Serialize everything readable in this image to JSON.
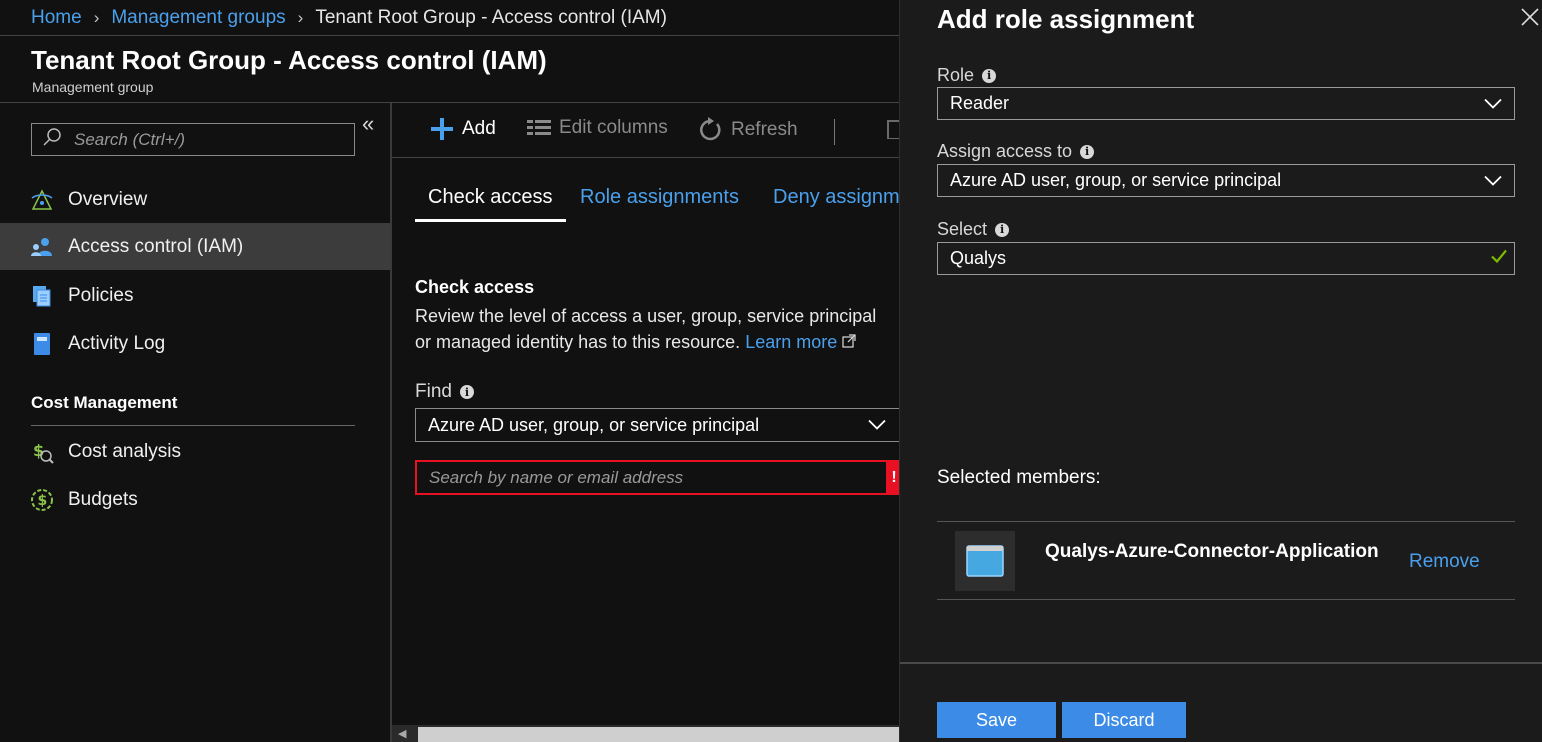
{
  "breadcrumb": {
    "home": "Home",
    "management_groups": "Management groups",
    "current": "Tenant Root Group - Access control (IAM)"
  },
  "header": {
    "title": "Tenant Root Group - Access control (IAM)",
    "subtitle": "Management group"
  },
  "sidebar": {
    "search_placeholder": "Search (Ctrl+/)",
    "collapse_glyph": "«",
    "items": [
      {
        "label": "Overview",
        "icon": "overview-icon"
      },
      {
        "label": "Access control (IAM)",
        "icon": "iam-people-icon",
        "active": true
      },
      {
        "label": "Policies",
        "icon": "policies-icon"
      },
      {
        "label": "Activity Log",
        "icon": "activity-log-icon"
      }
    ],
    "section_title": "Cost Management",
    "cost_items": [
      {
        "label": "Cost analysis",
        "icon": "cost-analysis-icon"
      },
      {
        "label": "Budgets",
        "icon": "budgets-icon"
      }
    ]
  },
  "toolbar": {
    "add": "Add",
    "edit_columns": "Edit columns",
    "refresh": "Refresh"
  },
  "tabs": {
    "check_access": "Check access",
    "role_assignments": "Role assignments",
    "deny_assignments": "Deny assignm"
  },
  "check_access": {
    "title": "Check access",
    "desc_line1": "Review the level of access a user, group, service principal",
    "desc_line2": "or managed identity has to this resource.",
    "learn_more": "Learn more",
    "find_label": "Find",
    "find_value": "Azure AD user, group, or service principal",
    "search_placeholder": "Search by name or email address",
    "error_glyph": "!"
  },
  "panel": {
    "title": "Add role assignment",
    "role_label": "Role",
    "role_value": "Reader",
    "assign_label": "Assign access to",
    "assign_value": "Azure AD user, group, or service principal",
    "select_label": "Select",
    "select_value": "Qualys",
    "selected_members_label": "Selected members:",
    "member_name": "Qualys-Azure-Connector-Application",
    "remove": "Remove",
    "save": "Save",
    "discard": "Discard"
  },
  "colors": {
    "accent": "#3c8ce7",
    "link": "#4aa0ec",
    "error": "#e81123",
    "success": "#7fba00",
    "background": "#111111",
    "panel": "#1b1b1b"
  }
}
